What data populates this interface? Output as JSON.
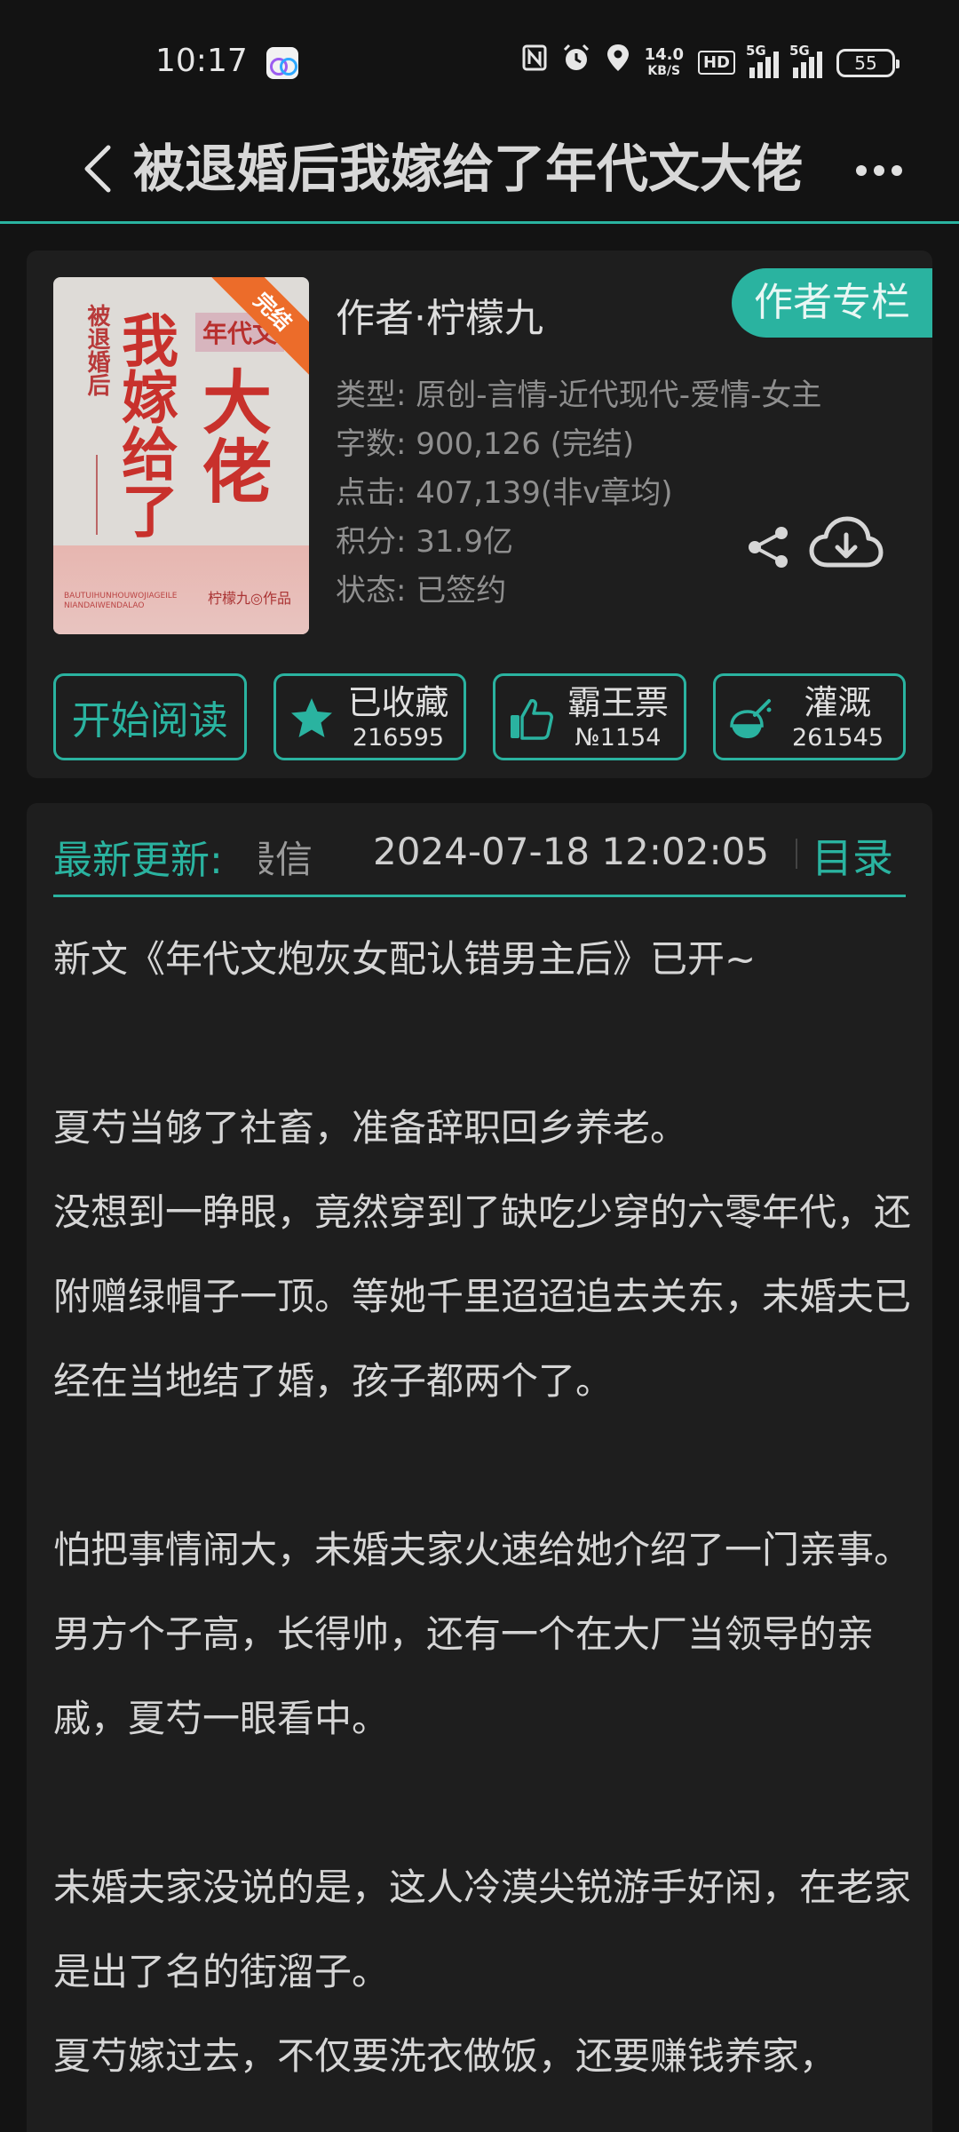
{
  "status_bar": {
    "time": "10:17",
    "speed_value": "14.0",
    "speed_unit": "KB/S",
    "hd_label": "HD",
    "signal1_label": "5G",
    "signal2_label": "5G",
    "battery": "55",
    "icons": [
      "nfc-icon",
      "alarm-icon",
      "location-icon"
    ]
  },
  "header": {
    "title": "被退婚后我嫁给了年代文大佬"
  },
  "book": {
    "cover": {
      "side_title": "被退婚后",
      "main_title_1": "我嫁给了",
      "main_title_2": "大佬",
      "tag": "年代文",
      "ribbon": "完结",
      "author_mark": "柠檬九◎作品",
      "small_text": "BAUTUIHUNHOUWOJIAGEILE NIANDAIWENDALAO"
    },
    "author": "作者·柠檬九",
    "author_column_button": "作者专栏",
    "info": {
      "type": "类型: 原创-言情-近代现代-爱情-女主",
      "word_count": "字数: 900,126 (完结)",
      "clicks": "点击: 407,139(非v章均)",
      "points": "积分: 31.9亿",
      "status": "状态: 已签约"
    },
    "actions": {
      "read_label": "开始阅读",
      "favorite_label": "已收藏",
      "favorite_count": "216595",
      "vote_label": "霸王票",
      "vote_count": "№1154",
      "irrigate_label": "灌溉",
      "irrigate_count": "261545"
    }
  },
  "update": {
    "label": "最新更新:",
    "chapter": "最信",
    "time": "2024-07-18 12:02:05",
    "catalog": "目录"
  },
  "description": [
    "新文《年代文炮灰女配认错男主后》已开~",
    "",
    "夏芍当够了社畜，准备辞职回乡养老。",
    "没想到一睁眼，竟然穿到了缺吃少穿的六零年代，还附赠绿帽子一顶。等她千里迢迢追去关东，未婚夫已经在当地结了婚，孩子都两个了。",
    "",
    "怕把事情闹大，未婚夫家火速给她介绍了一门亲事。",
    "男方个子高，长得帅，还有一个在大厂当领导的亲戚，夏芍一眼看中。",
    "",
    "未婚夫家没说的是，这人冷漠尖锐游手好闲，在老家是出了名的街溜子。",
    "夏芍嫁过去，不仅要洗衣做饭，还要赚钱养家，"
  ],
  "colors": {
    "accent": "#2ab3a0",
    "background": "#131313",
    "card": "#1e1e1e"
  }
}
